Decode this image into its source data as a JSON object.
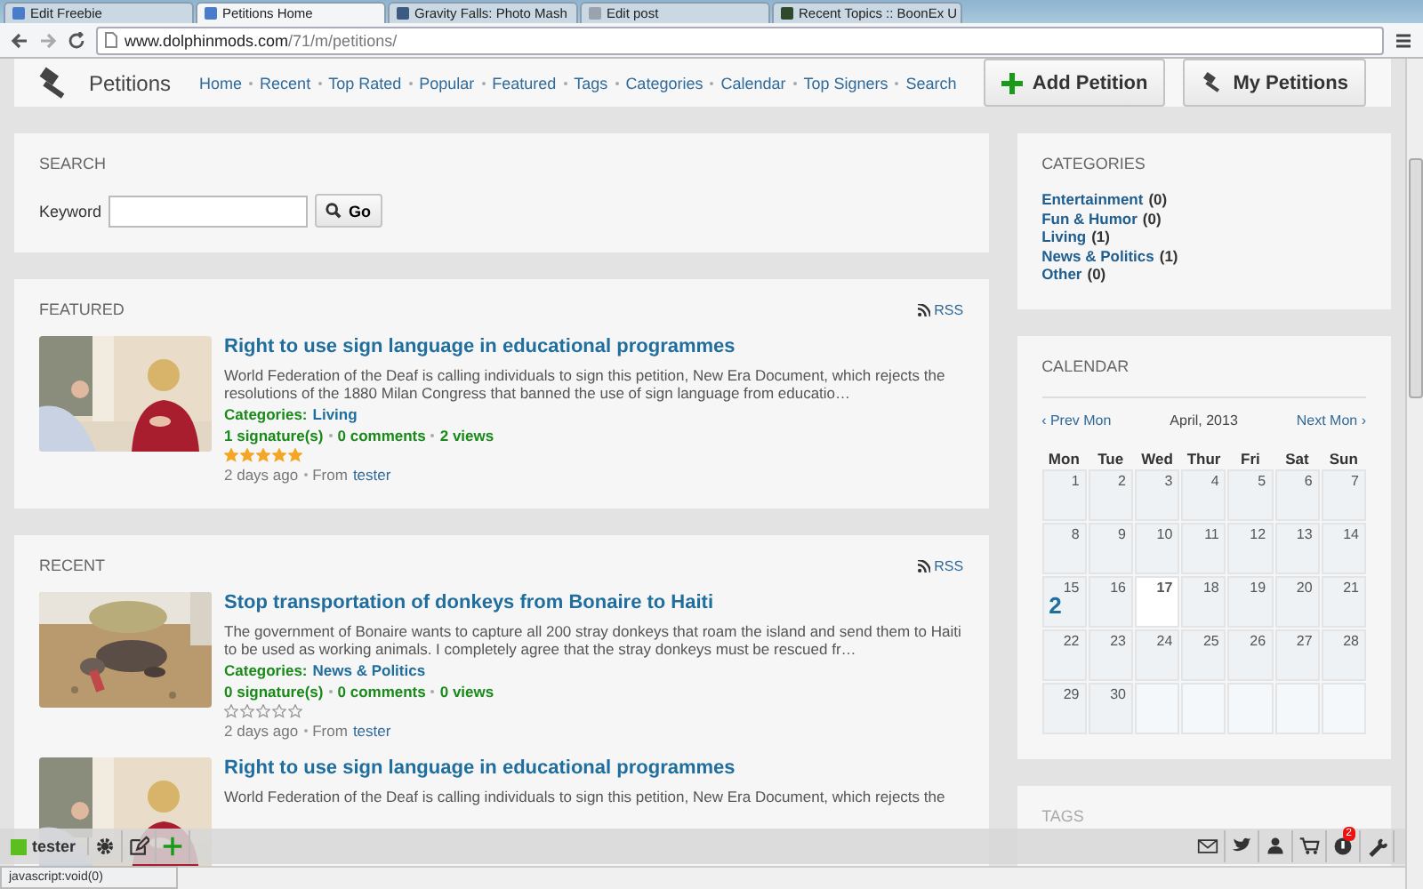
{
  "browser": {
    "tabs": [
      {
        "title": "Edit Freebie",
        "selected": false,
        "color": "#4a7cc9"
      },
      {
        "title": "Petitions Home",
        "selected": true,
        "color": "#4a7cc9"
      },
      {
        "title": "Gravity Falls: Photo Mash",
        "selected": false,
        "color": "#3d5a80"
      },
      {
        "title": "Edit post",
        "selected": false,
        "color": "#9aa3ad"
      },
      {
        "title": "Recent Topics :: BoonEx U",
        "selected": false,
        "color": "#2e4a2a"
      }
    ],
    "address": {
      "host": "www.dolphinmods.com",
      "path": "/71/m/petitions/"
    }
  },
  "header": {
    "title": "Petitions",
    "nav": [
      "Home",
      "Recent",
      "Top Rated",
      "Popular",
      "Featured",
      "Tags",
      "Categories",
      "Calendar",
      "Top Signers",
      "Search"
    ],
    "buttons": [
      {
        "label": "Add Petition",
        "kind": "add"
      },
      {
        "label": "My Petitions",
        "kind": "gavel"
      }
    ]
  },
  "search": {
    "title": "SEARCH",
    "label": "Keyword",
    "button": "Go"
  },
  "featured": {
    "title": "FEATURED",
    "rss": "RSS",
    "items": [
      {
        "kind": "people",
        "title": "Right to use sign language in educational programmes",
        "description": "World Federation of the Deaf is calling individuals to sign this petition, New Era Document, which rejects the resolutions of the 1880 Milan Congress that banned the use of sign language from educatio…",
        "categories_label": "Categories:",
        "category": "Living",
        "stats": [
          "1 signature(s)",
          "0 comments",
          "2 views"
        ],
        "stars": 5,
        "age": "2 days ago",
        "from": "From",
        "author": "tester"
      }
    ]
  },
  "recent": {
    "title": "RECENT",
    "rss": "RSS",
    "items": [
      {
        "kind": "donkey",
        "title": "Stop transportation of donkeys from Bonaire to Haiti",
        "description": "The government of Bonaire wants to capture all 200 stray donkeys that roam the island and send them to Haiti to be used as working animals. I completely agree that the stray donkeys must be rescued fr…",
        "categories_label": "Categories:",
        "category": "News & Politics",
        "stats": [
          "0 signature(s)",
          "0 comments",
          "0 views"
        ],
        "stars": 0,
        "age": "2 days ago",
        "from": "From",
        "author": "tester"
      },
      {
        "kind": "people",
        "title": "Right to use sign language in educational programmes",
        "description": "World Federation of the Deaf is calling individuals to sign this petition, New Era Document, which rejects the"
      }
    ]
  },
  "categories": {
    "title": "CATEGORIES",
    "items": [
      {
        "name": "Entertainment",
        "count": "(0)"
      },
      {
        "name": "Fun & Humor",
        "count": "(0)"
      },
      {
        "name": "Living",
        "count": "(1)"
      },
      {
        "name": "News & Politics",
        "count": "(1)"
      },
      {
        "name": "Other",
        "count": "(0)"
      }
    ]
  },
  "calendar": {
    "title": "CALENDAR",
    "prev": "‹ Prev Mon",
    "month": "April, 2013",
    "next": "Next Mon ›",
    "weekdays": [
      "Mon",
      "Tue",
      "Wed",
      "Thur",
      "Fri",
      "Sat",
      "Sun"
    ],
    "weeks": [
      [
        {
          "kind": "day",
          "day": "1",
          "today": false
        },
        {
          "kind": "day",
          "day": "2",
          "today": false
        },
        {
          "kind": "day",
          "day": "3",
          "today": false
        },
        {
          "kind": "day",
          "day": "4",
          "today": false
        },
        {
          "kind": "day",
          "day": "5",
          "today": false
        },
        {
          "kind": "day",
          "day": "6",
          "today": false
        },
        {
          "kind": "day",
          "day": "7",
          "today": false
        }
      ],
      [
        {
          "kind": "day",
          "day": "8",
          "today": false
        },
        {
          "kind": "day",
          "day": "9",
          "today": false
        },
        {
          "kind": "day",
          "day": "10",
          "today": false
        },
        {
          "kind": "day",
          "day": "11",
          "today": false
        },
        {
          "kind": "day",
          "day": "12",
          "today": false
        },
        {
          "kind": "day",
          "day": "13",
          "today": false
        },
        {
          "kind": "day",
          "day": "14",
          "today": false
        }
      ],
      [
        {
          "kind": "day",
          "day": "15",
          "today": false,
          "count": "2"
        },
        {
          "kind": "day",
          "day": "16",
          "today": false
        },
        {
          "kind": "day",
          "day": "17",
          "today": true
        },
        {
          "kind": "day",
          "day": "18",
          "today": false
        },
        {
          "kind": "day",
          "day": "19",
          "today": false
        },
        {
          "kind": "day",
          "day": "20",
          "today": false
        },
        {
          "kind": "day",
          "day": "21",
          "today": false
        }
      ],
      [
        {
          "kind": "day",
          "day": "22",
          "today": false
        },
        {
          "kind": "day",
          "day": "23",
          "today": false
        },
        {
          "kind": "day",
          "day": "24",
          "today": false
        },
        {
          "kind": "day",
          "day": "25",
          "today": false
        },
        {
          "kind": "day",
          "day": "26",
          "today": false
        },
        {
          "kind": "day",
          "day": "27",
          "today": false
        },
        {
          "kind": "day",
          "day": "28",
          "today": false
        }
      ],
      [
        {
          "kind": "day",
          "day": "29",
          "today": false
        },
        {
          "kind": "day",
          "day": "30",
          "today": false
        },
        {
          "kind": "blank"
        },
        {
          "kind": "blank"
        },
        {
          "kind": "blank"
        },
        {
          "kind": "blank"
        },
        {
          "kind": "blank"
        }
      ]
    ]
  },
  "tags": {
    "title": "TAGS"
  },
  "toolbar": {
    "user": "tester",
    "left": [
      {
        "kind": "gear"
      },
      {
        "kind": "edit"
      },
      {
        "kind": "plus"
      }
    ],
    "right": [
      {
        "kind": "mail"
      },
      {
        "kind": "bird"
      },
      {
        "kind": "user"
      },
      {
        "kind": "cart"
      },
      {
        "kind": "notice",
        "badge": "2"
      },
      {
        "kind": "wrench"
      }
    ]
  },
  "status_bar": "javascript:void(0)"
}
